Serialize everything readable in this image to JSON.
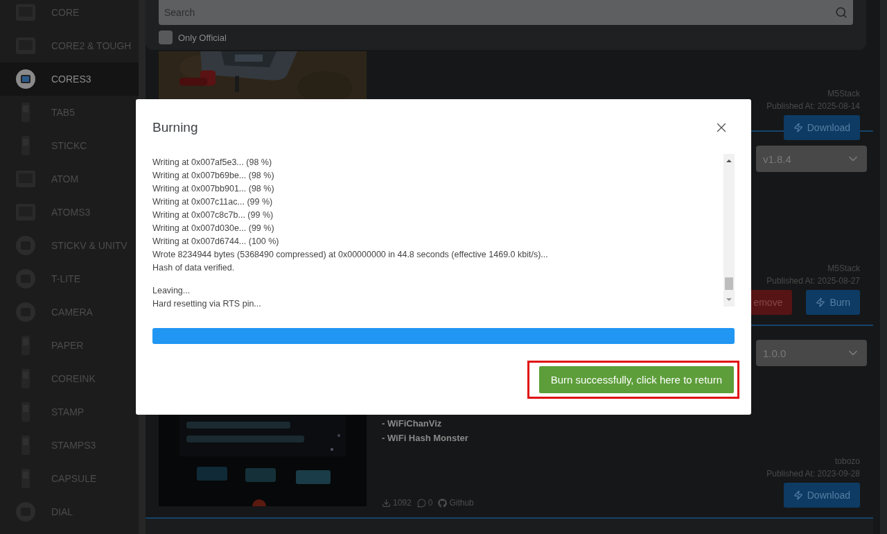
{
  "sidebar": {
    "items": [
      {
        "label": "CORE",
        "selected": false
      },
      {
        "label": "CORE2 & TOUGH",
        "selected": false
      },
      {
        "label": "CORES3",
        "selected": true
      },
      {
        "label": "TAB5",
        "selected": false
      },
      {
        "label": "STICKC",
        "selected": false
      },
      {
        "label": "ATOM",
        "selected": false
      },
      {
        "label": "ATOMS3",
        "selected": false
      },
      {
        "label": "STICKV & UNITV",
        "selected": false
      },
      {
        "label": "T-LITE",
        "selected": false
      },
      {
        "label": "CAMERA",
        "selected": false
      },
      {
        "label": "PAPER",
        "selected": false
      },
      {
        "label": "COREINK",
        "selected": false
      },
      {
        "label": "STAMP",
        "selected": false
      },
      {
        "label": "STAMPS3",
        "selected": false
      },
      {
        "label": "CAPSULE",
        "selected": false
      },
      {
        "label": "DIAL",
        "selected": false
      }
    ]
  },
  "search": {
    "placeholder": "Search"
  },
  "filters": [
    {
      "label": "Only Official",
      "checked": false
    }
  ],
  "cards": [
    {
      "media": {
        "kind": "picture"
      },
      "author": "M5Stack",
      "published": "Published At: 2025-08-14",
      "actions": [
        {
          "kind": "download",
          "label": "Download"
        }
      ]
    },
    {
      "version": "v1.8.4",
      "author": "M5Stack",
      "published": "Published At: 2025-08-27",
      "actions": [
        {
          "kind": "remove",
          "label": "emove"
        },
        {
          "kind": "burn",
          "label": "Burn"
        }
      ]
    },
    {
      "media": {
        "kind": "picture"
      },
      "version": "1.0.0",
      "description": [
        "- WiFiChanViz",
        "- WiFi Hash Monster"
      ],
      "stats": {
        "downloads": "1092",
        "comments": "0",
        "source": "Github"
      },
      "author": "tobozo",
      "published": "Published At: 2023-09-28",
      "actions": [
        {
          "kind": "download",
          "label": "Download"
        }
      ]
    }
  ],
  "modal": {
    "title": "Burning",
    "log_groups": [
      [
        "Writing at 0x007af5e3... (98 %)",
        "Writing at 0x007b69be... (98 %)",
        "Writing at 0x007bb901... (98 %)",
        "Writing at 0x007c11ac... (99 %)",
        "Writing at 0x007c8c7b... (99 %)",
        "Writing at 0x007d030e... (99 %)",
        "Writing at 0x007d6744... (100 %)",
        "Wrote 8234944 bytes (5368490 compressed) at 0x00000000 in 44.8 seconds (effective 1469.0 kbit/s)...",
        "Hash of data verified."
      ],
      [
        "Leaving...",
        "Hard resetting via RTS pin..."
      ]
    ],
    "progress": {
      "level": 1
    },
    "return_button": {
      "label": "Burn successfully, click here to return",
      "highlighted": true
    }
  }
}
